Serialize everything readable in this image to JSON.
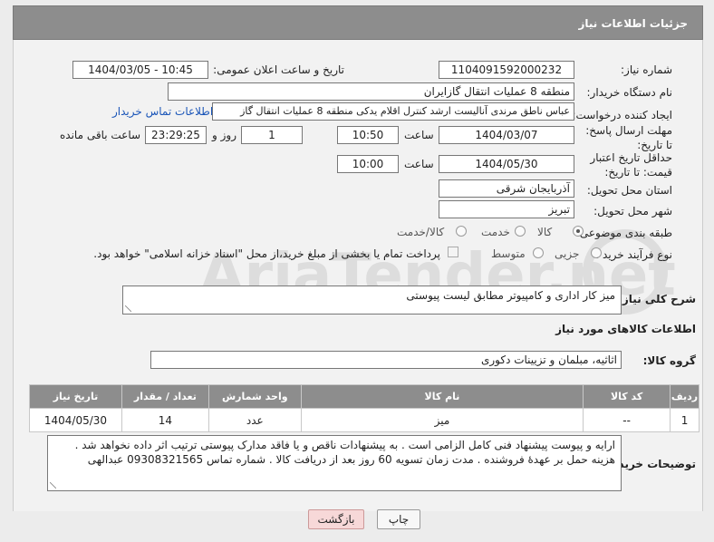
{
  "header": {
    "title": "جزئیات اطلاعات نیاز"
  },
  "form": {
    "need_number_label": "شماره نیاز:",
    "need_number": "1104091592000232",
    "announce_label": "تاریخ و ساعت اعلان عمومی:",
    "announce_value": "1404/03/05 - 10:45",
    "buyer_org_label": "نام دستگاه خریدار:",
    "buyer_org": "منطقه 8 عملیات انتقال گازایران",
    "creator_label": "ایجاد کننده درخواست:",
    "creator": "عباس ناطق مرندی آنالیست ارشد کنترل اقلام یدکی منطقه 8 عملیات انتقال گاز",
    "contact_link": "اطلاعات تماس خریدار",
    "reply_deadline_label": "مهلت ارسال پاسخ: تا تاریخ:",
    "reply_date": "1404/03/07",
    "time_label": "ساعت",
    "reply_time": "10:50",
    "days_value": "1",
    "days_label": "روز و",
    "remaining_time": "23:29:25",
    "remaining_label": "ساعت باقی مانده",
    "validity_label": "حداقل تاریخ اعتبار قیمت: تا تاریخ:",
    "validity_date": "1404/05/30",
    "validity_time": "10:00",
    "province_label": "استان محل تحویل:",
    "province": "آذربایجان شرقی",
    "city_label": "شهر محل تحویل:",
    "city": "تبریز",
    "category_label": "طبقه بندی موضوعی:",
    "category_options": [
      "کالا",
      "خدمت",
      "کالا/خدمت"
    ],
    "purchase_type_label": "نوع فرآیند خرید :",
    "purchase_options": [
      "جزیی",
      "متوسط"
    ],
    "payment_note": "پرداخت تمام یا بخشی از مبلغ خرید،از محل \"اسناد خزانه اسلامی\" خواهد بود."
  },
  "description": {
    "label": "شرح کلی نیاز:",
    "value": "میز کار اداری و کامپیوتر مطابق لیست پیوستی"
  },
  "goods": {
    "section_title": "اطلاعات کالاهای مورد نیاز",
    "group_label": "گروه کالا:",
    "group_value": "اثاثیه، مبلمان و تزیینات دکوری",
    "columns": [
      "ردیف",
      "کد کالا",
      "نام کالا",
      "واحد شمارش",
      "تعداد / مقدار",
      "تاریخ نیاز"
    ],
    "rows": [
      [
        "1",
        "--",
        "میز",
        "عدد",
        "14",
        "1404/05/30"
      ]
    ]
  },
  "buyer_notes": {
    "label": "توضیحات خریدار:",
    "value": "ارایه و پیوست پیشنهاد فنی کامل الزامی است . به پیشنهادات ناقص و یا فاقد مدارک پیوستی ترتیب اثر داده نخواهد شد . هزینه حمل بر عهدهٔ فروشنده . مدت زمان تسویه 60 روز بعد از دریافت کالا . شماره تماس 09308321565 عبدالهی"
  },
  "buttons": {
    "print": "چاپ",
    "back": "بازگشت"
  },
  "watermark": {
    "text": "AriaTender.net"
  },
  "colors": {
    "header_bg": "#8d8d8d",
    "link": "#1a55b8",
    "back_button": "#f7d8d8"
  }
}
